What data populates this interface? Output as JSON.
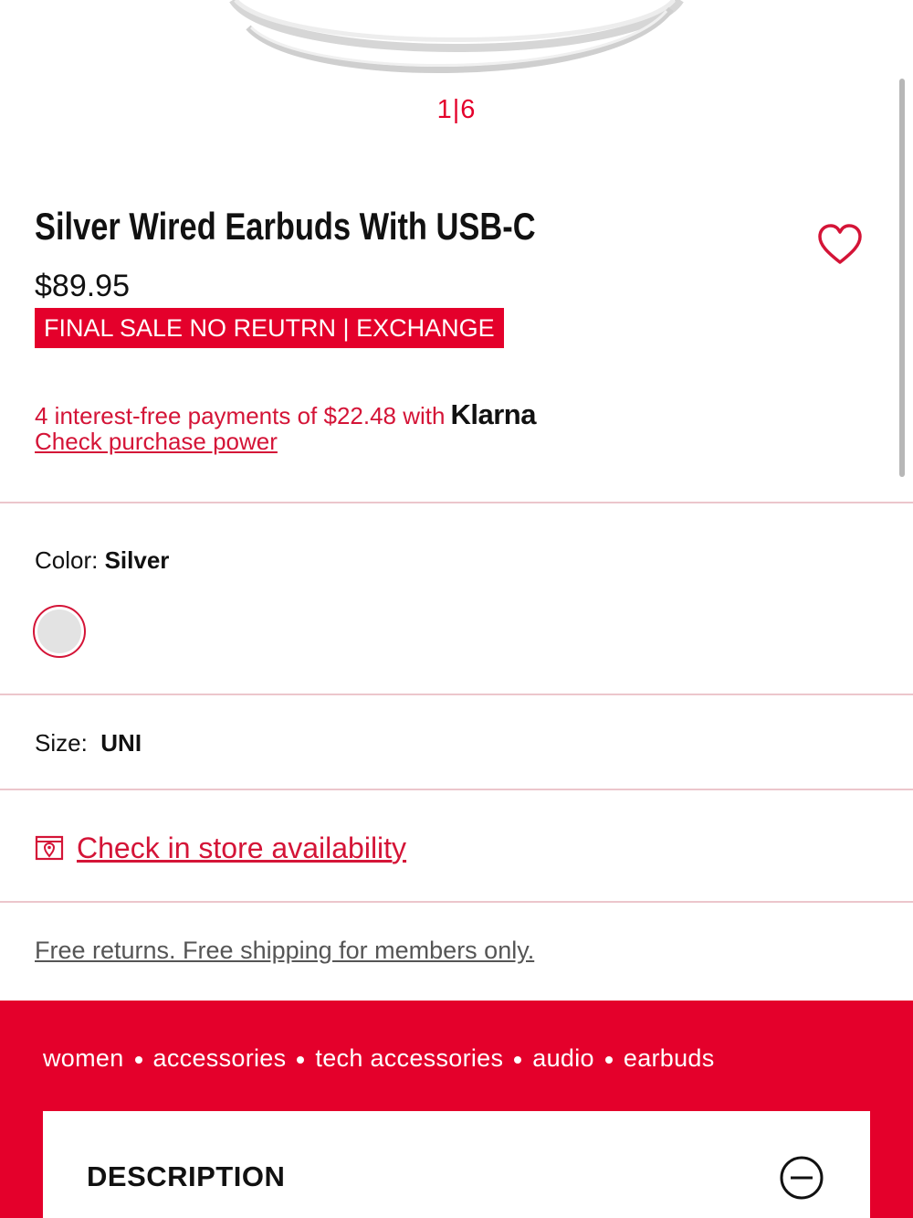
{
  "gallery": {
    "counter": "1|6"
  },
  "product": {
    "title": "Silver Wired Earbuds With USB-C",
    "price": "$89.95",
    "final_sale_badge": "FINAL SALE NO REUTRN | EXCHANGE"
  },
  "klarna": {
    "text": "4 interest-free payments of $22.48 with",
    "brand": "Klarna",
    "link": "Check purchase power"
  },
  "color": {
    "label": "Color:",
    "value": "Silver",
    "swatch_hex": "#e3e3e3"
  },
  "size": {
    "label": "Size:",
    "value": "UNI"
  },
  "store": {
    "link": "Check in store availability"
  },
  "shipping": {
    "text": "Free returns. Free shipping for members only."
  },
  "breadcrumbs": [
    "women",
    "accessories",
    "tech accessories",
    "audio",
    "earbuds"
  ],
  "description": {
    "title": "DESCRIPTION"
  },
  "colors": {
    "accent": "#e4002b",
    "link": "#d41437",
    "divider": "#ecc6cc"
  }
}
